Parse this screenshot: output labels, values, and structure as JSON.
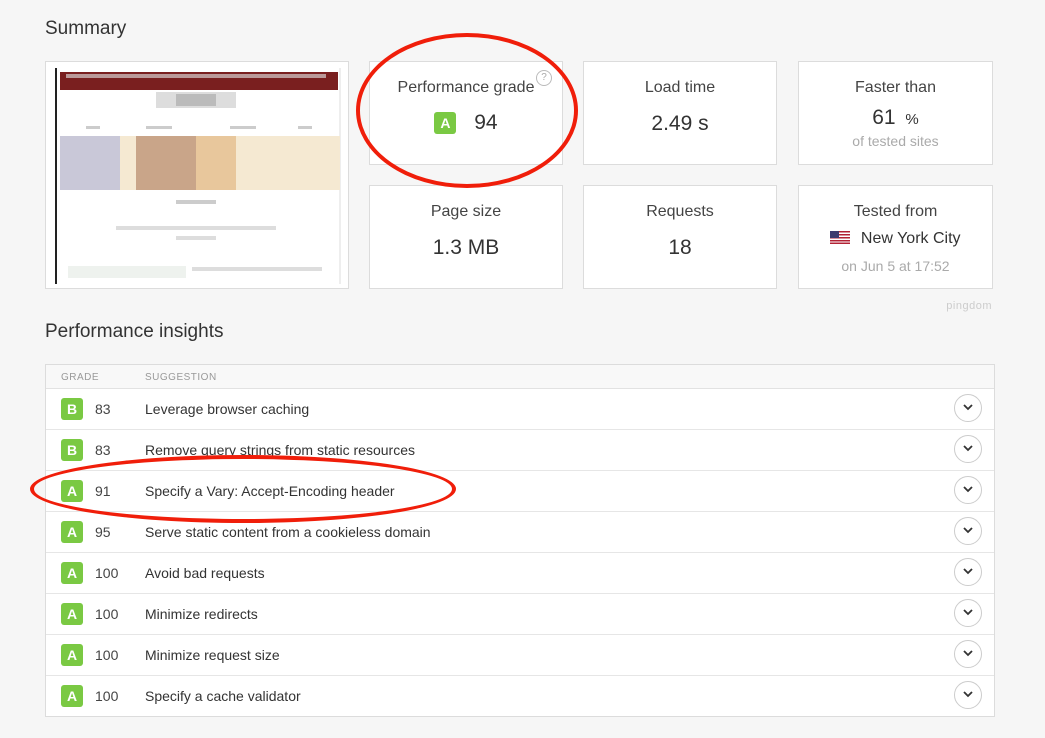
{
  "summary": {
    "title": "Summary",
    "performance_grade": {
      "label": "Performance grade",
      "grade": "A",
      "value": "94"
    },
    "load_time": {
      "label": "Load time",
      "value": "2.49 s"
    },
    "faster_than": {
      "label": "Faster than",
      "value": "61",
      "unit": "%",
      "sub": "of tested sites"
    },
    "page_size": {
      "label": "Page size",
      "value": "1.3 MB"
    },
    "requests": {
      "label": "Requests",
      "value": "18"
    },
    "tested_from": {
      "label": "Tested from",
      "location": "New York City",
      "date": "on Jun 5 at 17:52"
    },
    "brand": "pingdom"
  },
  "insights": {
    "title": "Performance insights",
    "columns": {
      "grade": "GRADE",
      "suggestion": "SUGGESTION"
    },
    "rows": [
      {
        "grade": "B",
        "score": "83",
        "suggestion": "Leverage browser caching"
      },
      {
        "grade": "B",
        "score": "83",
        "suggestion": "Remove query strings from static resources"
      },
      {
        "grade": "A",
        "score": "91",
        "suggestion": "Specify a Vary: Accept-Encoding header"
      },
      {
        "grade": "A",
        "score": "95",
        "suggestion": "Serve static content from a cookieless domain"
      },
      {
        "grade": "A",
        "score": "100",
        "suggestion": "Avoid bad requests"
      },
      {
        "grade": "A",
        "score": "100",
        "suggestion": "Minimize redirects"
      },
      {
        "grade": "A",
        "score": "100",
        "suggestion": "Minimize request size"
      },
      {
        "grade": "A",
        "score": "100",
        "suggestion": "Specify a cache validator"
      }
    ]
  },
  "colors": {
    "grade_green": "#7ac943",
    "annotation_red": "#f01e0a"
  }
}
